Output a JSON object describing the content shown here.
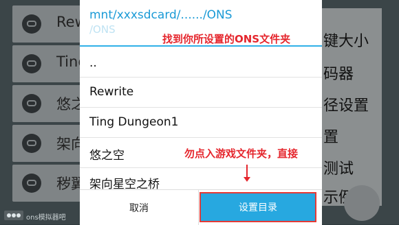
{
  "background_list": {
    "items": [
      {
        "label": "Rew"
      },
      {
        "label": "Ting"
      },
      {
        "label": "悠之"
      },
      {
        "label": "架向"
      },
      {
        "label": "秽翼"
      }
    ]
  },
  "background_menu": {
    "items": [
      {
        "label": "键大小"
      },
      {
        "label": "码器"
      },
      {
        "label": "径设置"
      },
      {
        "label": "置"
      },
      {
        "label": "测试"
      },
      {
        "label": "示例"
      }
    ]
  },
  "dialog": {
    "path": "mnt/xxxsdcard/....../ONS",
    "path_tail_faded": "/ONS",
    "files": [
      {
        "name": ".."
      },
      {
        "name": "Rewrite"
      },
      {
        "name": "Ting Dungeon1"
      },
      {
        "name": "悠之空"
      },
      {
        "name": "架向星空之桥"
      }
    ],
    "cancel_label": "取消",
    "set_dir_label": "设置目录"
  },
  "annotations": {
    "top": "找到你所设置的ONS文件夹",
    "bottom": "勿点入游戏文件夹，直接"
  },
  "watermark": {
    "text": "ons模拟器吧"
  },
  "colors": {
    "accent": "#27a8e0",
    "annotation_red": "#e5262d"
  }
}
